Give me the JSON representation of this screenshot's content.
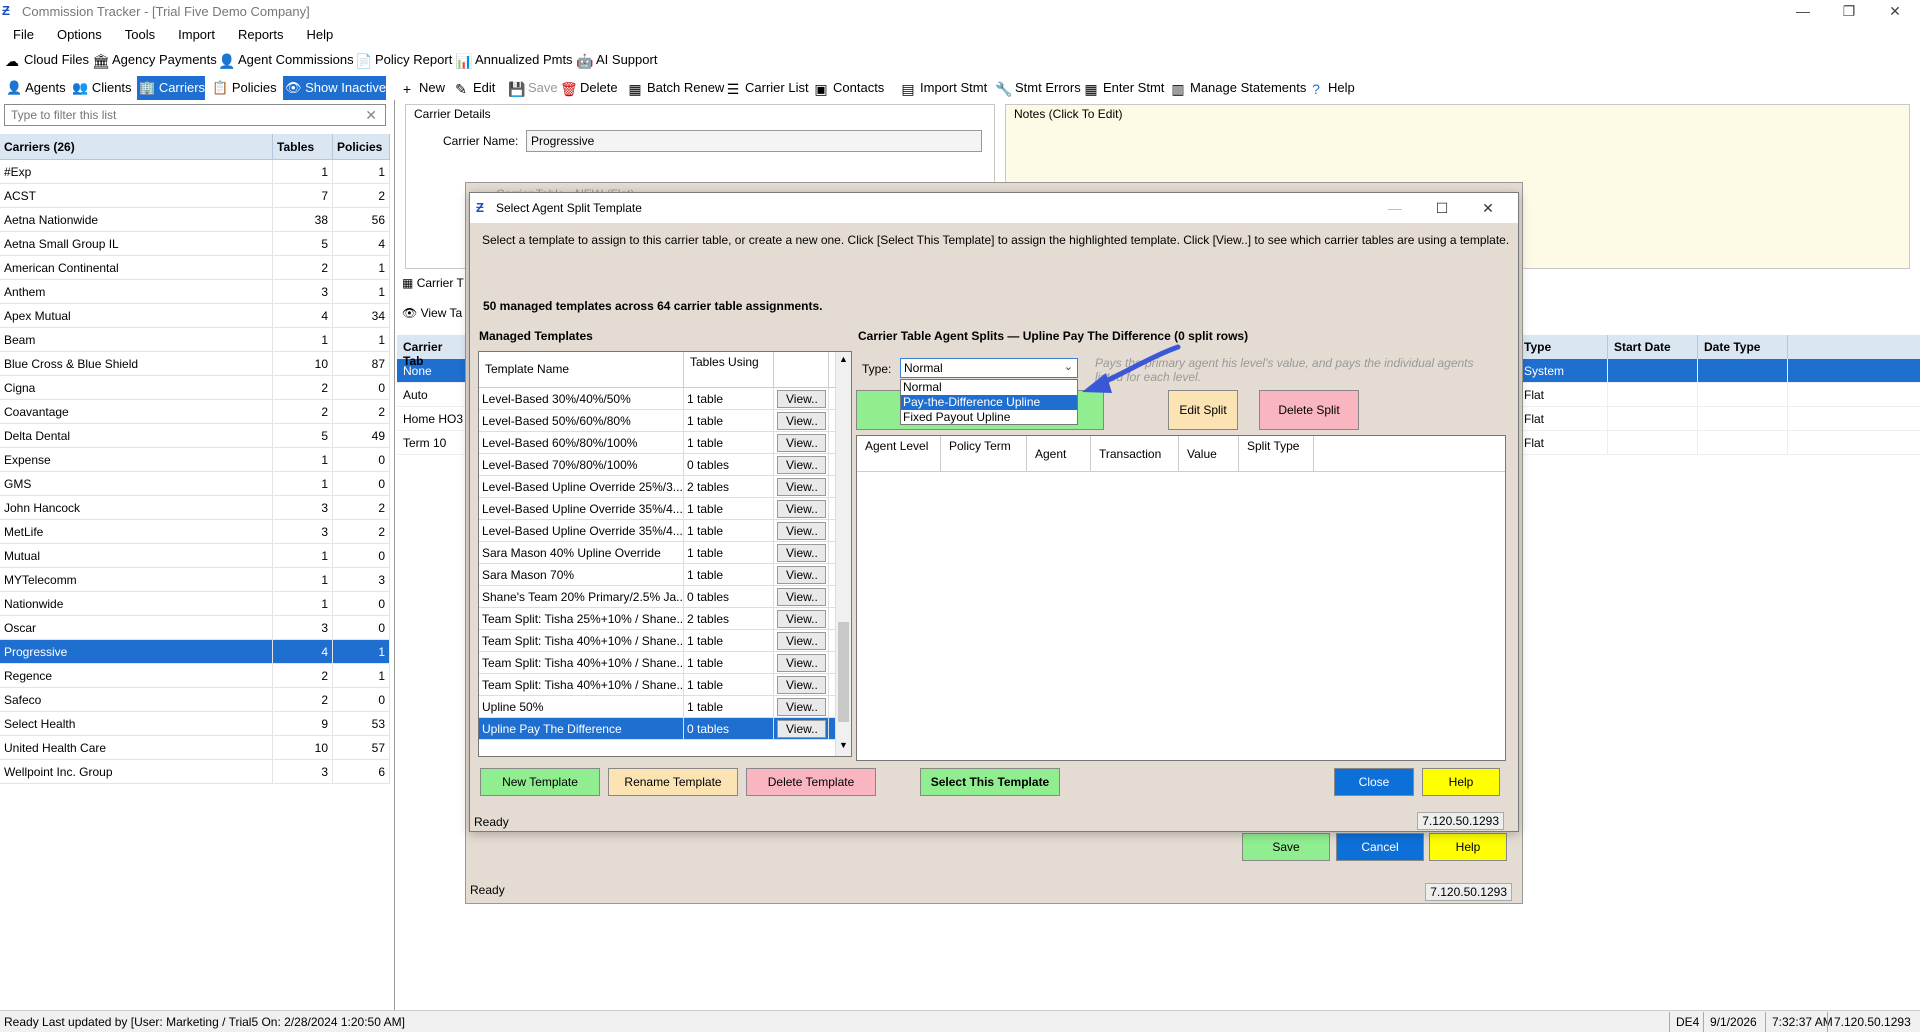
{
  "window": {
    "title": "Commission Tracker - [Trial Five Demo Company]"
  },
  "menu": [
    "File",
    "Options",
    "Tools",
    "Import",
    "Reports",
    "Help"
  ],
  "toolbar1": [
    "Cloud Files",
    "Agency Payments",
    "Agent Commissions",
    "Policy Report",
    "Annualized Pmts",
    "AI Support"
  ],
  "nav": [
    "Agents",
    "Clients",
    "Carriers",
    "Policies",
    "Show Inactive"
  ],
  "toolbar2": [
    "New",
    "Edit",
    "Save",
    "Delete",
    "Batch Renew",
    "Carrier List",
    "Contacts",
    "Import Stmt",
    "Stmt Errors",
    "Enter Stmt",
    "Manage Statements",
    "Help"
  ],
  "filter": {
    "placeholder": "Type to filter this list"
  },
  "carriers": {
    "header": [
      "Carriers (26)",
      "Tables",
      "Policies"
    ],
    "rows": [
      [
        "#Exp",
        "1",
        "1"
      ],
      [
        "ACST",
        "7",
        "2"
      ],
      [
        "Aetna Nationwide",
        "38",
        "56"
      ],
      [
        "Aetna Small Group IL",
        "5",
        "4"
      ],
      [
        "American Continental",
        "2",
        "1"
      ],
      [
        "Anthem",
        "3",
        "1"
      ],
      [
        "Apex Mutual",
        "4",
        "34"
      ],
      [
        "Beam",
        "1",
        "1"
      ],
      [
        "Blue Cross & Blue Shield",
        "10",
        "87"
      ],
      [
        "Cigna",
        "2",
        "0"
      ],
      [
        "Coavantage",
        "2",
        "2"
      ],
      [
        "Delta Dental",
        "5",
        "49"
      ],
      [
        "Expense",
        "1",
        "0"
      ],
      [
        "GMS",
        "1",
        "0"
      ],
      [
        "John Hancock",
        "3",
        "2"
      ],
      [
        "MetLife",
        "3",
        "2"
      ],
      [
        "Mutual",
        "1",
        "0"
      ],
      [
        "MYTelecomm",
        "1",
        "3"
      ],
      [
        "Nationwide",
        "1",
        "0"
      ],
      [
        "Oscar",
        "3",
        "0"
      ],
      [
        "Progressive",
        "4",
        "1"
      ],
      [
        "Regence",
        "2",
        "1"
      ],
      [
        "Safeco",
        "2",
        "0"
      ],
      [
        "Select Health",
        "9",
        "53"
      ],
      [
        "United Health Care",
        "10",
        "57"
      ],
      [
        "Wellpoint Inc. Group",
        "3",
        "6"
      ]
    ]
  },
  "details": {
    "label": "Carrier Details",
    "name_label": "Carrier Name:",
    "name_value": "Progressive",
    "notes_label": "Notes  (Click To Edit)"
  },
  "tabs": [
    "Carrier T",
    "View Ta"
  ],
  "carrier_tables": {
    "header_left": "Carrier Tab",
    "header_right": [
      "Type",
      "Start Date",
      "Date Type"
    ],
    "rows": [
      [
        "None",
        "System"
      ],
      [
        "Auto",
        "Flat"
      ],
      [
        "Home HO3",
        "Flat"
      ],
      [
        "Term 10",
        "Flat"
      ]
    ]
  },
  "back_dialog": {
    "title": "Carrier Table - NEW (Flat)",
    "status": "Ready",
    "version": "7.120.50.1293",
    "save": "Save",
    "cancel": "Cancel",
    "help": "Help"
  },
  "dialog": {
    "title": "Select Agent Split Template",
    "instructions": "Select a template to assign to this carrier table, or create a new one. Click [Select This Template] to assign the highlighted template. Click [View..] to see which carrier tables are using a template.",
    "count": "50 managed templates across 64 carrier table assignments.",
    "managed_label": "Managed Templates",
    "templates_header": [
      "Template Name",
      "Tables Using"
    ],
    "view_label": "View..",
    "templates": [
      [
        "Level-Based 30%/40%/50%",
        "1 table"
      ],
      [
        "Level-Based 50%/60%/80%",
        "1 table"
      ],
      [
        "Level-Based 60%/80%/100%",
        "1 table"
      ],
      [
        "Level-Based 70%/80%/100%",
        "0 tables"
      ],
      [
        "Level-Based Upline Override 25%/3...",
        "2 tables"
      ],
      [
        "Level-Based Upline Override 35%/4...",
        "1 table"
      ],
      [
        "Level-Based Upline Override 35%/4...",
        "1 table"
      ],
      [
        "Sara Mason 40% Upline Override",
        "1 table"
      ],
      [
        "Sara Mason 70%",
        "1 table"
      ],
      [
        "Shane's Team 20% Primary/2.5% Ja...",
        "0 tables"
      ],
      [
        "Team Split: Tisha 25%+10% / Shane...",
        "2 tables"
      ],
      [
        "Team Split: Tisha 40%+10% / Shane...",
        "1 table"
      ],
      [
        "Team Split: Tisha 40%+10% / Shane...",
        "1 table"
      ],
      [
        "Team Split: Tisha 40%+10% / Shane...",
        "1 table"
      ],
      [
        "Upline 50%",
        "1 table"
      ],
      [
        "Upline Pay The Difference",
        "0 tables"
      ]
    ],
    "splits_label": "Carrier Table Agent Splits — Upline Pay The Difference  (0 split rows)",
    "type_label": "Type:",
    "type_value": "Normal",
    "type_options": [
      "Normal",
      "Pay-the-Difference Upline",
      "Fixed Payout Upline"
    ],
    "type_desc": "Pays the primary agent his level's value, and pays the individual agents listed for each level.",
    "add_agent": "Agent",
    "edit_split": "Edit Split",
    "delete_split": "Delete Split",
    "splits_header": [
      "Agent Level",
      "Policy Term",
      "Agent",
      "Transaction",
      "Value",
      "Split Type"
    ],
    "new_template": "New Template",
    "rename_template": "Rename Template",
    "delete_template": "Delete Template",
    "select_template": "Select This Template",
    "close": "Close",
    "help": "Help",
    "status": "Ready",
    "version": "7.120.50.1293"
  },
  "status": {
    "left": "Ready   Last updated by [User: Marketing / Trial5 On: 2/28/2024 1:20:50 AM]",
    "cells": [
      "DE4",
      "9/1/2026",
      "7:32:37 AM",
      "7.120.50.1293"
    ]
  },
  "colors": {
    "accent": "#1e6fd0",
    "green": "#90ee90",
    "yellow": "#ffff00",
    "pink": "#f9b6c1",
    "peach": "#fbe3b3"
  }
}
